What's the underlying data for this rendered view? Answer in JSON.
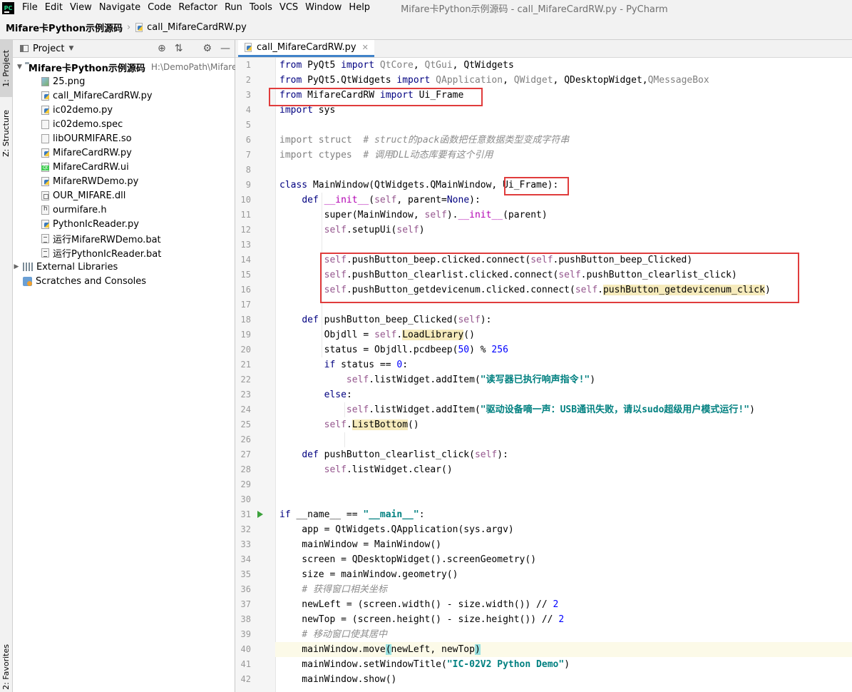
{
  "menubar": {
    "items": [
      "File",
      "Edit",
      "View",
      "Navigate",
      "Code",
      "Refactor",
      "Run",
      "Tools",
      "VCS",
      "Window",
      "Help"
    ],
    "window_title": "Mifare卡Python示例源码 - call_MifareCardRW.py - PyCharm"
  },
  "navbar": {
    "root": "Mifare卡Python示例源码",
    "file": "call_MifareCardRW.py"
  },
  "left_strip": {
    "project_tab": "1: Project",
    "structure_tab": "Z: Structure",
    "favorites_tab": "2: Favorites"
  },
  "project_panel": {
    "header": "Project",
    "root_name": "Mifare卡Python示例源码",
    "root_path": "H:\\DemoPath\\Mifare-",
    "files": [
      {
        "name": "25.png",
        "icon": "png-file-icon"
      },
      {
        "name": "call_MifareCardRW.py",
        "icon": "python-file-icon"
      },
      {
        "name": "ic02demo.py",
        "icon": "python-file-icon"
      },
      {
        "name": "ic02demo.spec",
        "icon": "text-file-icon"
      },
      {
        "name": "libOURMIFARE.so",
        "icon": "text-file-icon"
      },
      {
        "name": "MifareCardRW.py",
        "icon": "python-file-icon"
      },
      {
        "name": "MifareCardRW.ui",
        "icon": "qt-ui-file-icon"
      },
      {
        "name": "MifareRWDemo.py",
        "icon": "python-file-icon"
      },
      {
        "name": "OUR_MIFARE.dll",
        "icon": "dll-file-icon"
      },
      {
        "name": "ourmifare.h",
        "icon": "header-file-icon"
      },
      {
        "name": "PythonIcReader.py",
        "icon": "python-file-icon"
      },
      {
        "name": "运行MifareRWDemo.bat",
        "icon": "bat-file-icon"
      },
      {
        "name": "运行PythonIcReader.bat",
        "icon": "bat-file-icon"
      }
    ],
    "external_libraries": "External Libraries",
    "scratches": "Scratches and Consoles"
  },
  "editor": {
    "tab_label": "call_MifareCardRW.py",
    "lines": [
      {
        "n": "1",
        "t": [
          [
            "from",
            "kw"
          ],
          [
            " PyQt5 ",
            ""
          ],
          [
            "import",
            "kw"
          ],
          [
            " QtCore",
            "gr"
          ],
          [
            ", ",
            ""
          ],
          [
            "QtGui",
            "gr"
          ],
          [
            ", QtWidgets",
            ""
          ]
        ]
      },
      {
        "n": "2",
        "t": [
          [
            "from",
            "kw"
          ],
          [
            " PyQt5.QtWidgets ",
            ""
          ],
          [
            "import",
            "kw"
          ],
          [
            " QApplication",
            "gr"
          ],
          [
            ", ",
            ""
          ],
          [
            "QWidget",
            "gr"
          ],
          [
            ", QDesktopWidget,",
            ""
          ],
          [
            "QMessageBox",
            "gr"
          ]
        ]
      },
      {
        "n": "3",
        "t": [
          [
            "from",
            "kw"
          ],
          [
            " MifareCardRW ",
            ""
          ],
          [
            "import",
            "kw"
          ],
          [
            " Ui_Frame",
            ""
          ]
        ]
      },
      {
        "n": "4",
        "t": [
          [
            "import",
            "kw"
          ],
          [
            " sys",
            ""
          ]
        ]
      },
      {
        "n": "5",
        "t": []
      },
      {
        "n": "6",
        "t": [
          [
            "import struct",
            "gr"
          ],
          [
            "  ",
            ""
          ],
          [
            "# struct的pack函数把任意数据类型变成字符串",
            "cm"
          ]
        ]
      },
      {
        "n": "7",
        "t": [
          [
            "import ctypes",
            "gr"
          ],
          [
            "  ",
            ""
          ],
          [
            "# 调用DLL动态库要有这个引用",
            "cm"
          ]
        ]
      },
      {
        "n": "8",
        "t": []
      },
      {
        "n": "9",
        "t": [
          [
            "class",
            "kw"
          ],
          [
            " MainWindow(QtWidgets.QMainWindow, Ui_Frame):",
            ""
          ]
        ]
      },
      {
        "n": "10",
        "t": [
          [
            "    ",
            ""
          ],
          [
            "def",
            "kw"
          ],
          [
            " ",
            ""
          ],
          [
            "__init__",
            "fn"
          ],
          [
            "(",
            ""
          ],
          [
            "self",
            "sf"
          ],
          [
            ", parent=",
            ""
          ],
          [
            "None",
            "kw"
          ],
          [
            "):",
            ""
          ]
        ]
      },
      {
        "n": "11",
        "t": [
          [
            "        super(MainWindow, ",
            ""
          ],
          [
            "self",
            "sf"
          ],
          [
            ").",
            ""
          ],
          [
            "__init__",
            "fn"
          ],
          [
            "(parent)",
            ""
          ]
        ]
      },
      {
        "n": "12",
        "t": [
          [
            "        ",
            ""
          ],
          [
            "self",
            "sf"
          ],
          [
            ".setupUi(",
            ""
          ],
          [
            "self",
            "sf"
          ],
          [
            ")",
            ""
          ]
        ]
      },
      {
        "n": "13",
        "t": []
      },
      {
        "n": "14",
        "t": [
          [
            "        ",
            ""
          ],
          [
            "self",
            "sf"
          ],
          [
            ".pushButton_beep.clicked.connect(",
            ""
          ],
          [
            "self",
            "sf"
          ],
          [
            ".pushButton_beep_Clicked)",
            ""
          ]
        ]
      },
      {
        "n": "15",
        "t": [
          [
            "        ",
            ""
          ],
          [
            "self",
            "sf"
          ],
          [
            ".pushButton_clearlist.clicked.connect(",
            ""
          ],
          [
            "self",
            "sf"
          ],
          [
            ".pushButton_clearlist_click)",
            ""
          ]
        ]
      },
      {
        "n": "16",
        "t": [
          [
            "        ",
            ""
          ],
          [
            "self",
            "sf"
          ],
          [
            ".pushButton_getdevicenum.clicked.connect(",
            ""
          ],
          [
            "self",
            "sf"
          ],
          [
            ".",
            ""
          ],
          [
            "pushButton_getdevicenum_click",
            "hl"
          ],
          [
            ")",
            ""
          ]
        ]
      },
      {
        "n": "17",
        "t": []
      },
      {
        "n": "18",
        "t": [
          [
            "    ",
            ""
          ],
          [
            "def",
            "kw"
          ],
          [
            " pushButton_beep_Clicked(",
            ""
          ],
          [
            "self",
            "sf"
          ],
          [
            "):",
            ""
          ]
        ]
      },
      {
        "n": "19",
        "t": [
          [
            "        Objdll = ",
            ""
          ],
          [
            "self",
            "sf"
          ],
          [
            ".",
            ""
          ],
          [
            "LoadLibrary",
            "hl"
          ],
          [
            "()",
            ""
          ]
        ]
      },
      {
        "n": "20",
        "t": [
          [
            "        status = Objdll.pcdbeep(",
            ""
          ],
          [
            "50",
            "num"
          ],
          [
            ") % ",
            ""
          ],
          [
            "256",
            "num"
          ]
        ]
      },
      {
        "n": "21",
        "t": [
          [
            "        ",
            ""
          ],
          [
            "if",
            "kw"
          ],
          [
            " status == ",
            ""
          ],
          [
            "0",
            "num"
          ],
          [
            ":",
            ""
          ]
        ]
      },
      {
        "n": "22",
        "t": [
          [
            "            ",
            ""
          ],
          [
            "self",
            "sf"
          ],
          [
            ".listWidget.addItem(",
            ""
          ],
          [
            "\"读写器已执行响声指令!\"",
            "str"
          ],
          [
            ")",
            ""
          ]
        ]
      },
      {
        "n": "23",
        "t": [
          [
            "        ",
            ""
          ],
          [
            "else",
            "kw"
          ],
          [
            ":",
            ""
          ]
        ]
      },
      {
        "n": "24",
        "t": [
          [
            "            ",
            ""
          ],
          [
            "self",
            "sf"
          ],
          [
            ".listWidget.addItem(",
            ""
          ],
          [
            "\"驱动设备嘀一声：USB通讯失败，请以sudo超级用户模式运行!\"",
            "str"
          ],
          [
            ")",
            ""
          ]
        ]
      },
      {
        "n": "25",
        "t": [
          [
            "        ",
            ""
          ],
          [
            "self",
            "sf"
          ],
          [
            ".",
            ""
          ],
          [
            "ListBottom",
            "hl"
          ],
          [
            "()",
            ""
          ]
        ]
      },
      {
        "n": "26",
        "t": []
      },
      {
        "n": "27",
        "t": [
          [
            "    ",
            ""
          ],
          [
            "def",
            "kw"
          ],
          [
            " pushButton_clearlist_click(",
            ""
          ],
          [
            "self",
            "sf"
          ],
          [
            "):",
            ""
          ]
        ]
      },
      {
        "n": "28",
        "t": [
          [
            "        ",
            ""
          ],
          [
            "self",
            "sf"
          ],
          [
            ".listWidget.clear()",
            ""
          ]
        ]
      },
      {
        "n": "29",
        "t": []
      },
      {
        "n": "30",
        "t": []
      },
      {
        "n": "31",
        "t": [
          [
            "if",
            "kw"
          ],
          [
            " __name__ == ",
            ""
          ],
          [
            "\"__main__\"",
            "str"
          ],
          [
            ":",
            ""
          ]
        ]
      },
      {
        "n": "32",
        "t": [
          [
            "    app = QtWidgets.QApplication(sys.argv)",
            ""
          ]
        ]
      },
      {
        "n": "33",
        "t": [
          [
            "    mainWindow = MainWindow()",
            ""
          ]
        ]
      },
      {
        "n": "34",
        "t": [
          [
            "    screen = QDesktopWidget().screenGeometry()",
            ""
          ]
        ]
      },
      {
        "n": "35",
        "t": [
          [
            "    size = mainWindow.geometry()",
            ""
          ]
        ]
      },
      {
        "n": "36",
        "t": [
          [
            "    ",
            ""
          ],
          [
            "# 获得窗口相关坐标",
            "cm"
          ]
        ]
      },
      {
        "n": "37",
        "t": [
          [
            "    newLeft = (screen.width() - size.width()) // ",
            ""
          ],
          [
            "2",
            "num"
          ]
        ]
      },
      {
        "n": "38",
        "t": [
          [
            "    newTop = (screen.height() - size.height()) // ",
            ""
          ],
          [
            "2",
            "num"
          ]
        ]
      },
      {
        "n": "39",
        "t": [
          [
            "    ",
            ""
          ],
          [
            "# 移动窗口使其居中",
            "cm"
          ]
        ]
      },
      {
        "n": "40",
        "t": [
          [
            "    mainWindow.move",
            ""
          ],
          [
            "(",
            "bhl"
          ],
          [
            "newLeft, newTop",
            ""
          ],
          [
            ")",
            "bhl"
          ]
        ]
      },
      {
        "n": "41",
        "t": [
          [
            "    mainWindow.setWindowTitle(",
            ""
          ],
          [
            "\"IC-02V2 Python Demo\"",
            "str"
          ],
          [
            ")",
            ""
          ]
        ]
      },
      {
        "n": "42",
        "t": [
          [
            "    mainWindow.show()",
            ""
          ]
        ]
      }
    ]
  }
}
